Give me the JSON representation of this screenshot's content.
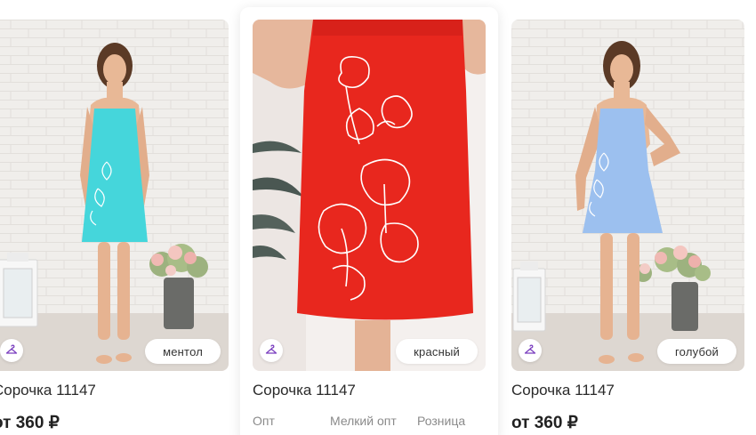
{
  "products": [
    {
      "title": "Сорочка 11147",
      "price": "от 360 ₽",
      "color_label": "ментол",
      "dress_color": "#45d6db"
    },
    {
      "title": "Сорочка 11147",
      "color_label": "красный",
      "dress_color": "#e8271e",
      "price_tiers": [
        "Опт",
        "Мелкий опт",
        "Розница"
      ]
    },
    {
      "title": "Сорочка 11147",
      "price": "от 360 ₽",
      "color_label": "голубой",
      "dress_color": "#9cc0ef"
    }
  ],
  "icons": {
    "hanger": "hanger-icon"
  },
  "colors": {
    "accent": "#7b3fbf",
    "wall": "#eeecea",
    "floor": "#d8d2cc"
  }
}
